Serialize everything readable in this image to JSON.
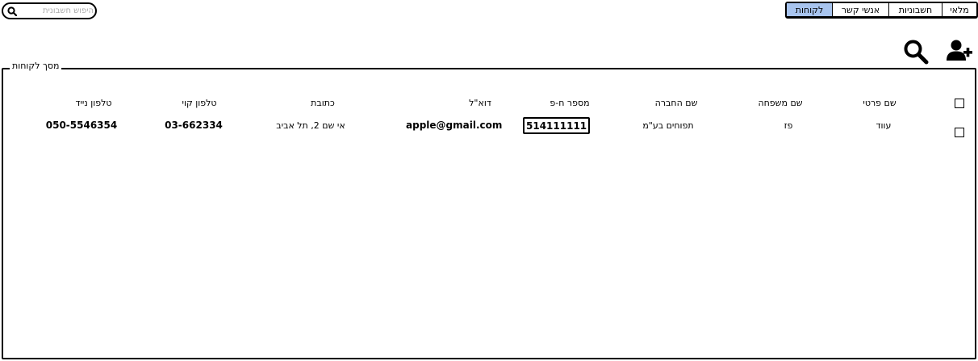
{
  "search": {
    "placeholder": "היפוש חשבונית"
  },
  "tabs": [
    {
      "label": "לקוחות",
      "active": true
    },
    {
      "label": "אנשי קשר",
      "active": false
    },
    {
      "label": "חשבוניות",
      "active": false
    },
    {
      "label": "מלאי",
      "active": false
    }
  ],
  "toolbar": {
    "search_icon": "search-icon",
    "add_icon": "add-user-icon"
  },
  "panel": {
    "title": "מסך לקוחות"
  },
  "table": {
    "headers": {
      "first_name": "שם פרטי",
      "last_name": "שם משפחה",
      "company": "שם החברה",
      "company_id": "מספר ח-פ",
      "email": "דוא\"ל",
      "address": "כתובת",
      "phone": "טלפון קוי",
      "mobile": "טלפון נייד"
    },
    "rows": [
      {
        "first_name": "עווד",
        "last_name": "פז",
        "company": "תפוחים בע\"מ",
        "company_id": "514111111",
        "email": "apple@gmail.com",
        "address": "אי שם 2, תל אביב",
        "phone": "03-662334",
        "mobile": "050-5546354"
      }
    ]
  },
  "colors": {
    "active_tab": "#a8c4ee",
    "stroke": "#000000"
  }
}
